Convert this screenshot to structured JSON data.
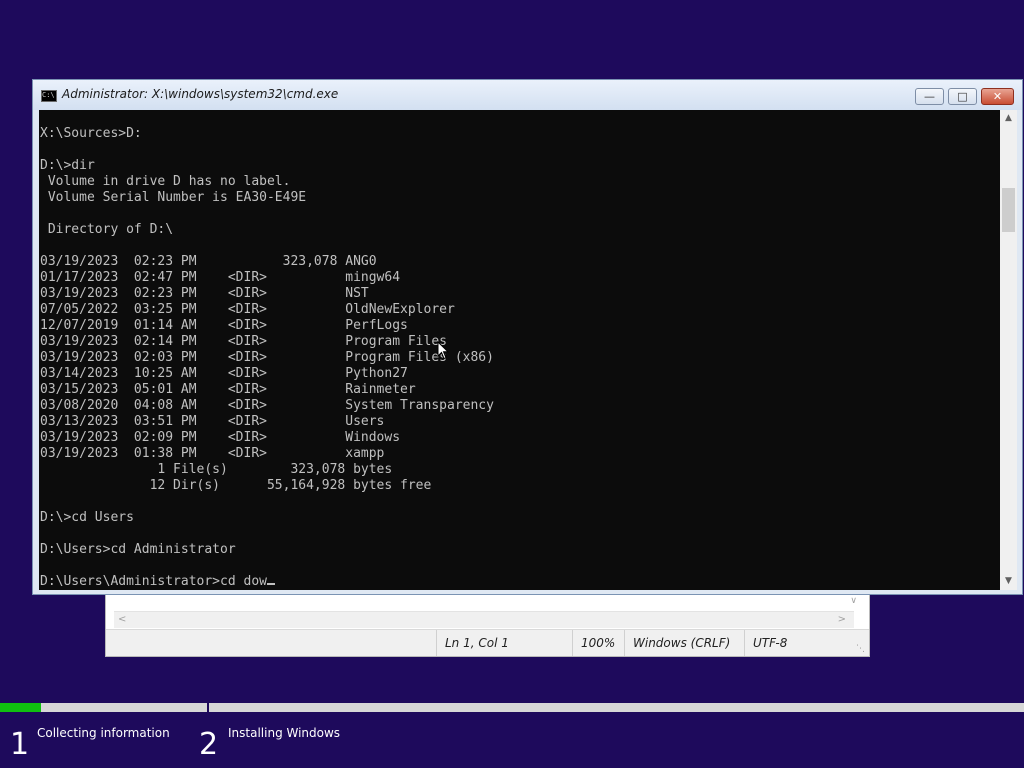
{
  "notepad": {
    "status": {
      "position": "Ln 1, Col 1",
      "zoom": "100%",
      "line_endings": "Windows (CRLF)",
      "encoding": "UTF-8"
    }
  },
  "cmd": {
    "title": "Administrator: X:\\windows\\system32\\cmd.exe",
    "buttons": {
      "minimize": "—",
      "maximize": "□",
      "close": "✕"
    },
    "icon_label": "C:\\",
    "output": "X:\\Sources>D:\n\nD:\\>dir\n Volume in drive D has no label.\n Volume Serial Number is EA30-E49E\n\n Directory of D:\\\n\n03/19/2023  02:23 PM           323,078 ANG0\n01/17/2023  02:47 PM    <DIR>          mingw64\n03/19/2023  02:23 PM    <DIR>          NST\n07/05/2022  03:25 PM    <DIR>          OldNewExplorer\n12/07/2019  01:14 AM    <DIR>          PerfLogs\n03/19/2023  02:14 PM    <DIR>          Program Files\n03/19/2023  02:03 PM    <DIR>          Program Files (x86)\n03/14/2023  10:25 AM    <DIR>          Python27\n03/15/2023  05:01 AM    <DIR>          Rainmeter\n03/08/2020  04:08 AM    <DIR>          System Transparency\n03/13/2023  03:51 PM    <DIR>          Users\n03/19/2023  02:09 PM    <DIR>          Windows\n03/19/2023  01:38 PM    <DIR>          xampp\n               1 File(s)        323,078 bytes\n              12 Dir(s)      55,164,928 bytes free\n\nD:\\>cd Users\n\nD:\\Users>cd Administrator\n\n",
    "prompt_line": "D:\\Users\\Administrator>cd dow"
  },
  "setup": {
    "progress_fraction": 0.04,
    "steps": [
      {
        "number": "1",
        "label": "Collecting information"
      },
      {
        "number": "2",
        "label": "Installing Windows"
      }
    ]
  },
  "colors": {
    "desktop": "#1e0a5c",
    "progress": "#10c010",
    "console_bg": "#0c0c0c",
    "console_fg": "#c0c0c0"
  }
}
